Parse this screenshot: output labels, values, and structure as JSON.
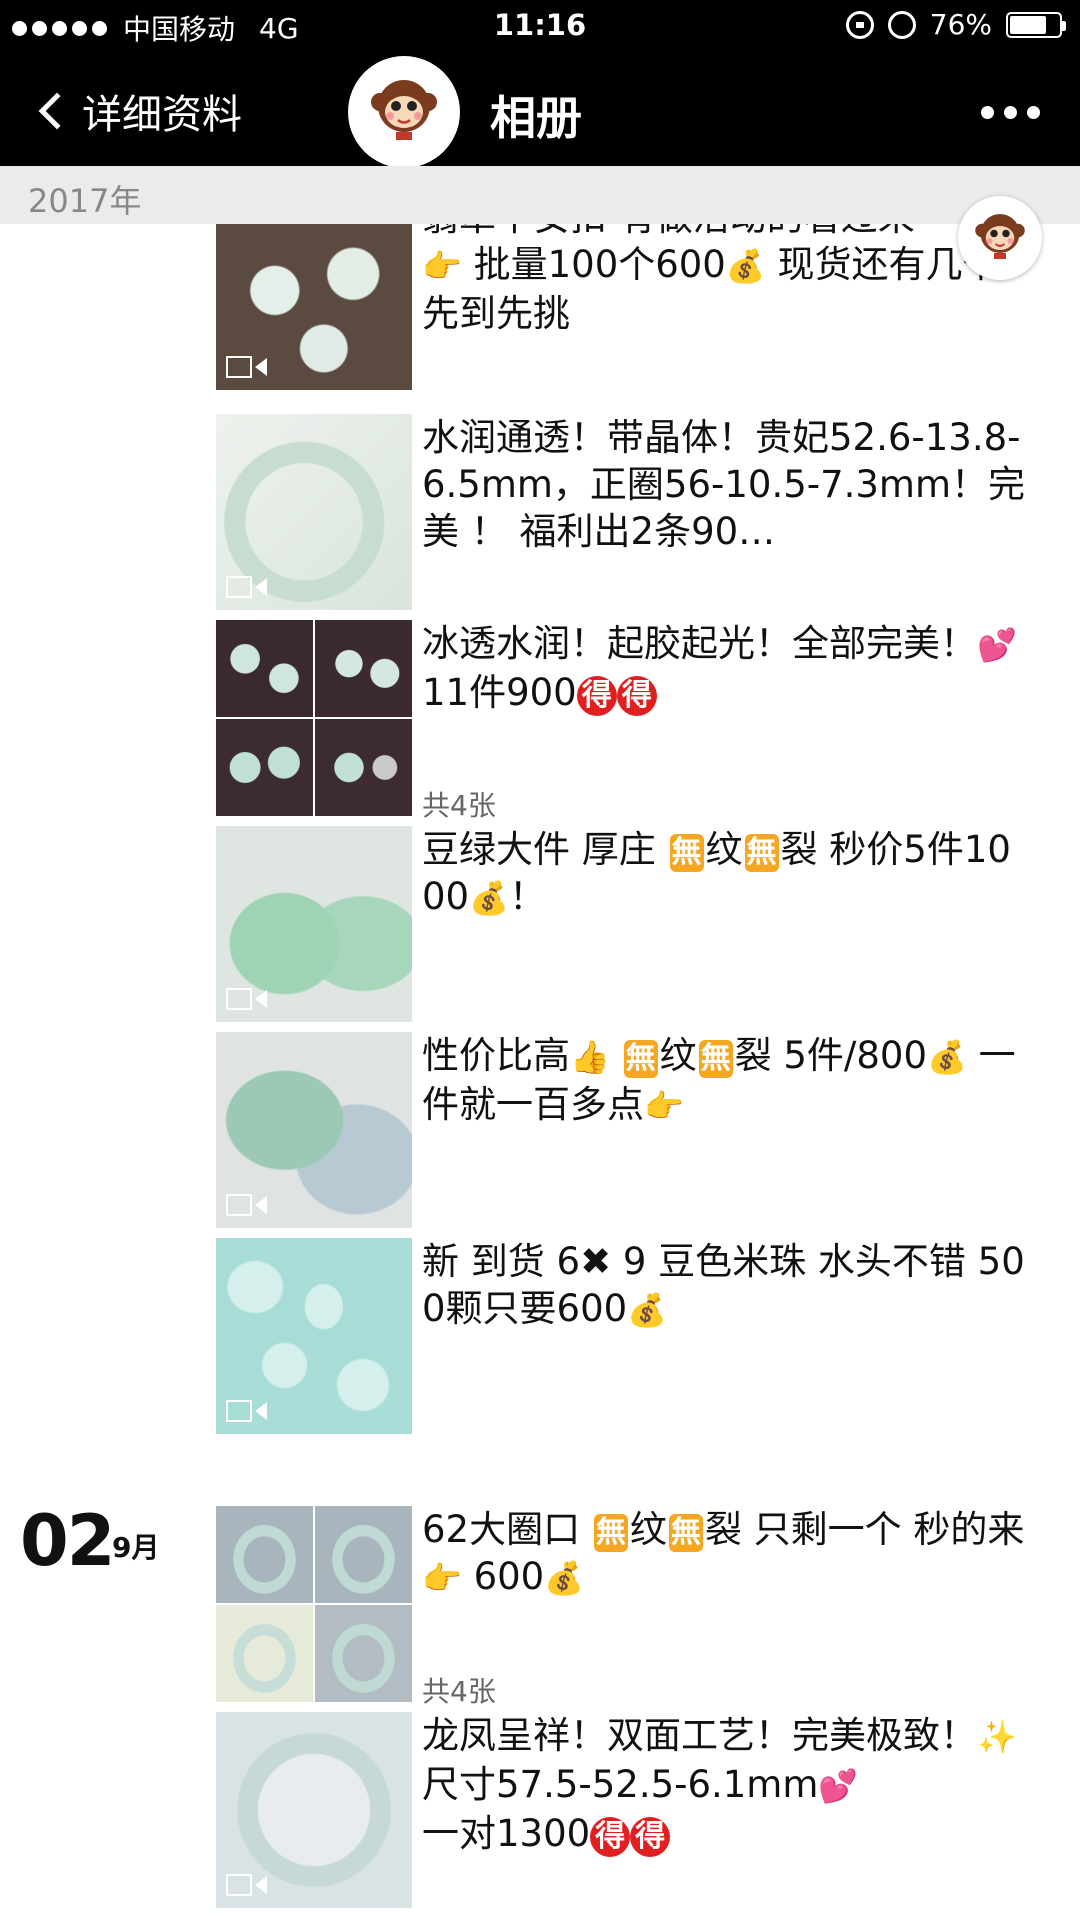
{
  "status": {
    "carrier": "中国移动",
    "network": "4G",
    "time": "11:16",
    "battery": "76%",
    "battery_level": 0.76
  },
  "nav": {
    "back_label": "详细资料",
    "title": "相册",
    "avatar_caption": "Lovely Monkey"
  },
  "year": "2017年",
  "date": {
    "day": "02",
    "month": "9月"
  },
  "emoji": {
    "point": "👉",
    "money": "💰",
    "heart": "💕",
    "thumb": "👍",
    "sparkle": "✨",
    "mu": "無",
    "de": "得",
    "x": "✖"
  },
  "posts": [
    {
      "text_parts": [
        "翡翠平安扣 有做活动的看过来",
        "批量100个600",
        "现货还有几千 先到先挑"
      ],
      "video": true
    },
    {
      "text": "水润通透！带晶体！贵妃52.6-13.8-6.5mm，正圈56-10.5-7.3mm！完美 ！ 福利出2条90…",
      "video": true
    },
    {
      "text_parts": [
        "冰透水润！起胶起光！全部完美！",
        "11件900"
      ],
      "count": "共4张"
    },
    {
      "text_parts": [
        "豆绿大件 厚庄 ",
        "纹",
        "裂  秒价5件1000",
        "！"
      ],
      "video": true
    },
    {
      "text_parts": [
        "性价比高",
        "纹",
        "裂  5件/800",
        " 一件就一百多点"
      ],
      "video": true
    },
    {
      "text_parts": [
        "新 到货 6",
        " 9  豆色米珠  水头不错  500颗只要600"
      ],
      "video": true
    },
    {
      "text_parts": [
        "62大圈口 ",
        "纹",
        "裂 只剩一个 秒的来",
        " 600"
      ],
      "count": "共4张"
    },
    {
      "text_parts": [
        "龙凤呈祥！双面工艺！完美极致！",
        "尺寸57.5-52.5-6.1mm",
        "一对1300"
      ],
      "video": true
    }
  ]
}
